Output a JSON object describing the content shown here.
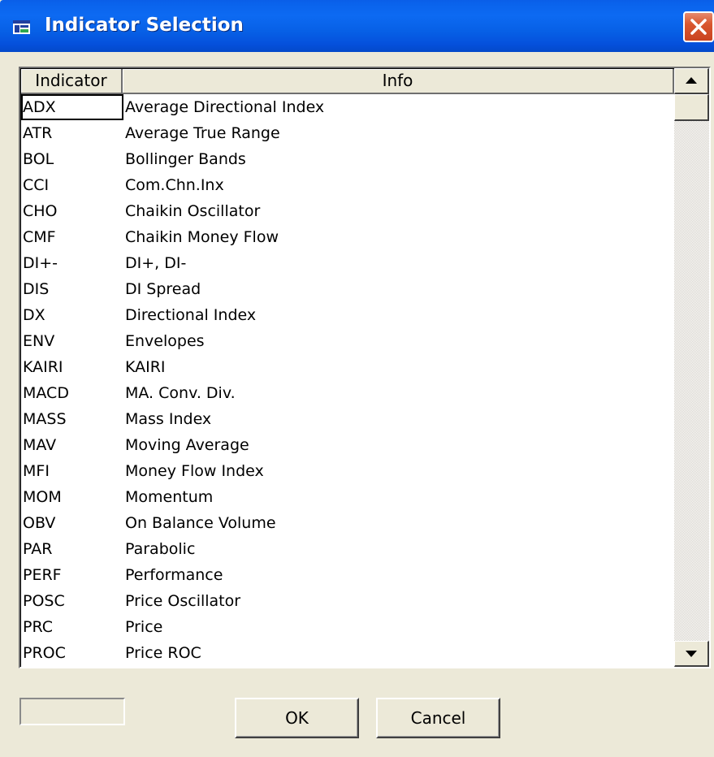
{
  "window": {
    "title": "Indicator Selection",
    "close_icon": "close-icon",
    "title_icon": "window-icon"
  },
  "grid": {
    "columns": [
      "Indicator",
      "Info"
    ],
    "selected_row": 0,
    "rows": [
      {
        "indicator": "ADX",
        "info": "Average Directional Index"
      },
      {
        "indicator": "ATR",
        "info": "Average True Range"
      },
      {
        "indicator": "BOL",
        "info": "Bollinger Bands"
      },
      {
        "indicator": "CCI",
        "info": "Com.Chn.Inx"
      },
      {
        "indicator": "CHO",
        "info": "Chaikin Oscillator"
      },
      {
        "indicator": "CMF",
        "info": "Chaikin Money Flow"
      },
      {
        "indicator": "DI+-",
        "info": "DI+, DI-"
      },
      {
        "indicator": "DIS",
        "info": "DI Spread"
      },
      {
        "indicator": "DX",
        "info": "Directional Index"
      },
      {
        "indicator": "ENV",
        "info": "Envelopes"
      },
      {
        "indicator": "KAIRI",
        "info": "KAIRI"
      },
      {
        "indicator": "MACD",
        "info": "MA. Conv. Div."
      },
      {
        "indicator": "MASS",
        "info": "Mass Index"
      },
      {
        "indicator": "MAV",
        "info": "Moving Average"
      },
      {
        "indicator": "MFI",
        "info": "Money Flow Index"
      },
      {
        "indicator": "MOM",
        "info": "Momentum"
      },
      {
        "indicator": "OBV",
        "info": "On Balance Volume"
      },
      {
        "indicator": "PAR",
        "info": "Parabolic"
      },
      {
        "indicator": "PERF",
        "info": "Performance"
      },
      {
        "indicator": "POSC",
        "info": "Price Oscillator"
      },
      {
        "indicator": "PRC",
        "info": "Price"
      },
      {
        "indicator": "PROC",
        "info": "Price ROC"
      }
    ]
  },
  "buttons": {
    "ok_label": "OK",
    "cancel_label": "Cancel"
  },
  "status_box": {
    "value": ""
  },
  "colors": {
    "title_bar": "#0a63ec",
    "window_bg": "#ece9d8",
    "close_button": "#d9572f"
  }
}
